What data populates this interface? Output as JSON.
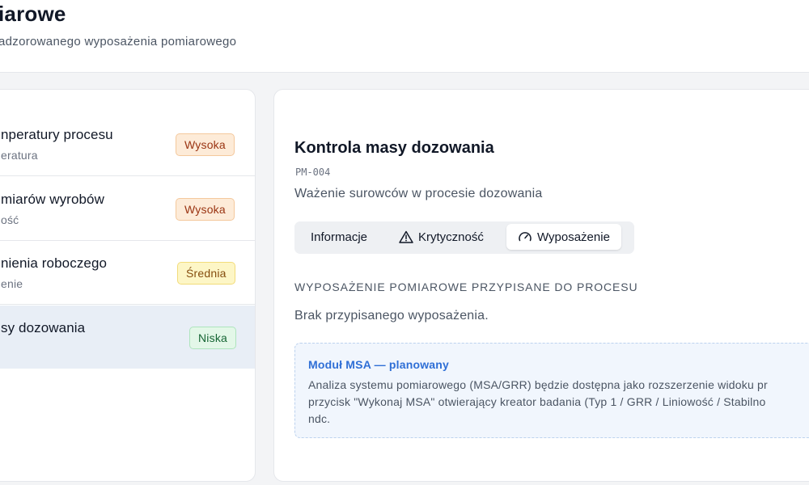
{
  "header": {
    "title": "iarowe",
    "subtitle": "adzorowanego wyposażenia pomiarowego"
  },
  "processes": [
    {
      "title": "nperatury procesu",
      "subtitle": "eratura",
      "badge": "Wysoka"
    },
    {
      "title": "miarów wyrobów",
      "subtitle": "ość",
      "badge": "Wysoka"
    },
    {
      "title": "nienia roboczego",
      "subtitle": "enie",
      "badge": "Średnia"
    },
    {
      "title": "sy dozowania",
      "subtitle": "",
      "badge": "Niska"
    }
  ],
  "detail": {
    "title": "Kontrola masy dozowania",
    "code": "PM-004",
    "description": "Ważenie surowców w procesie dozowania",
    "tabs": {
      "info": "Informacje",
      "criticality": "Krytyczność",
      "equipment": "Wyposażenie"
    },
    "section_label": "WYPOSAŻENIE POMIAROWE PRZYPISANE DO PROCESU",
    "empty_text": "Brak przypisanego wyposażenia.",
    "msa": {
      "title": "Moduł MSA — planowany",
      "line1": "Analiza systemu pomiarowego (MSA/GRR) będzie dostępna jako rozszerzenie widoku pr",
      "line2": "przycisk \"Wykonaj MSA\" otwierający kreator badania (Typ 1 / GRR / Liniowość / Stabilno",
      "line3": "ndc."
    }
  },
  "colors": {
    "active_row": "#e8eef6",
    "badge_high": "#fdebd8",
    "badge_medium": "#fdf6c6",
    "badge_low": "#e3f7e8",
    "accent": "#2f6fd6"
  },
  "icons": {
    "criticality": "warning-triangle-icon",
    "equipment": "gauge-icon"
  }
}
